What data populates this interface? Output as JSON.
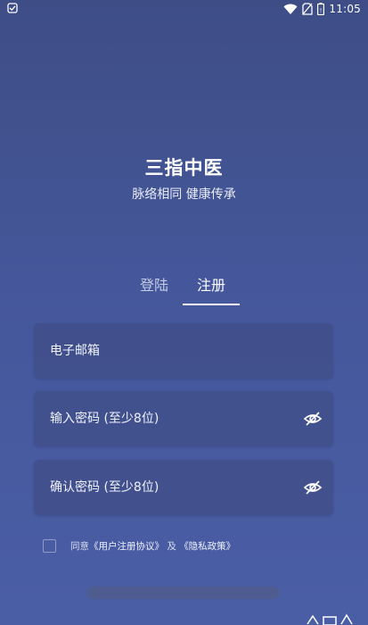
{
  "status_bar": {
    "time": "11:05",
    "icons": [
      "app-notification-icon",
      "wifi-icon",
      "no-sim-icon",
      "battery-icon"
    ]
  },
  "app": {
    "title": "三指中医",
    "subtitle": "脉络相同 健康传承"
  },
  "tabs": {
    "login": "登陆",
    "register": "注册",
    "active": "register"
  },
  "form": {
    "email_placeholder": "电子邮箱",
    "password_placeholder": "输入密码 (至少8位)",
    "confirm_placeholder": "确认密码 (至少8位)"
  },
  "agreement": {
    "prefix": "同意",
    "user_agreement": "《用户注册协议》",
    "conjunction": "及",
    "privacy_policy": "《隐私政策》",
    "checked": false
  },
  "colors": {
    "background_top": "#3e4d86",
    "background_bottom": "#4a5ea6",
    "field_background": "#404e87",
    "text_primary": "#ffffff",
    "tab_inactive": "#c2cbe6"
  }
}
